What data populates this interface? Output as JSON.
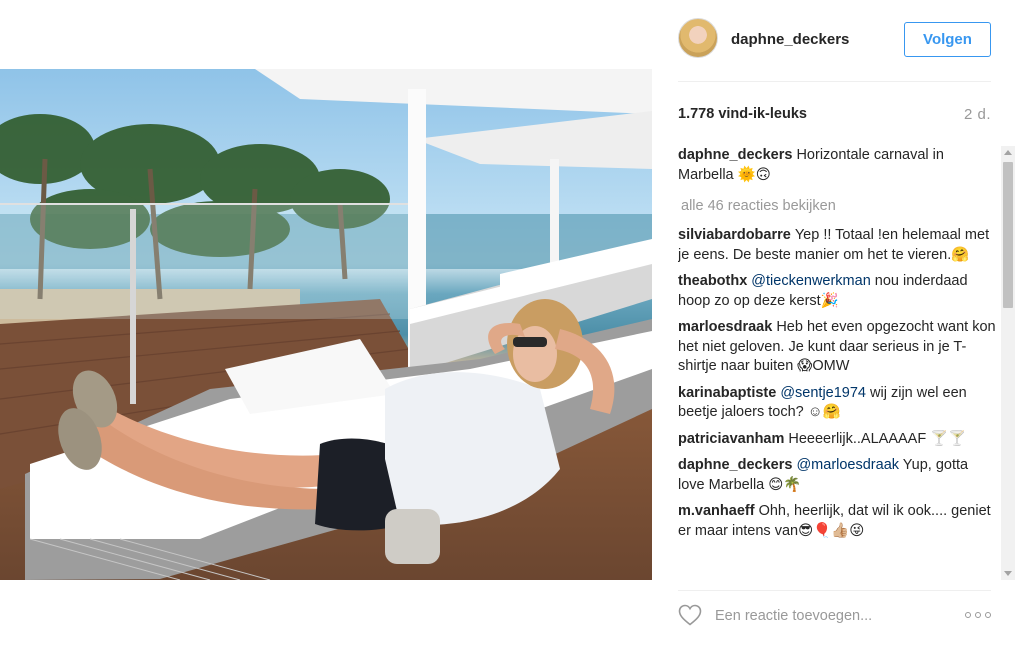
{
  "post": {
    "username": "daphne_deckers",
    "follow_label": "Volgen",
    "likes": "1.778 vind-ik-leuks",
    "age": "2 d.",
    "view_all": "alle 46 reacties bekijken",
    "add_comment_placeholder": "Een reactie toevoegen...",
    "caption": {
      "user": "daphne_deckers",
      "text": "Horizontale carnaval in Marbella 🌞🙃"
    }
  },
  "comments": [
    {
      "user": "silviabardobarre",
      "text": "Yep !! Totaal !en helemaal met je eens. De beste manier om het te vieren.🤗"
    },
    {
      "user": "theabothx",
      "mention": "@tieckenwerkman",
      "text": "nou inderdaad hoop zo op deze kerst🎉"
    },
    {
      "user": "marloesdraak",
      "text": "Heb het even opgezocht want kon het niet geloven. Je kunt daar serieus in je T-shirtje naar buiten 😱OMW"
    },
    {
      "user": "karinabaptiste",
      "mention": "@sentje1974",
      "text": "wij zijn wel een beetje jaloers toch? ☺🤗"
    },
    {
      "user": "patriciavanham",
      "text": "Heeeerlijk..ALAAAAF 🍸🍸"
    },
    {
      "user": "daphne_deckers",
      "mention": "@marloesdraak",
      "text": "Yup, gotta love Marbella 😊🌴"
    },
    {
      "user": "m.vanhaeff",
      "text": "Ohh, heerlijk, dat wil ik ook.... geniet er maar intens van😎🎈👍🏼😜"
    }
  ],
  "colors": {
    "accent": "#3897f0",
    "text": "#262626",
    "muted": "#999999",
    "mention": "#003569",
    "divider": "#efefef"
  },
  "icons": {
    "heart": "heart-icon",
    "more": "more-options-icon"
  }
}
